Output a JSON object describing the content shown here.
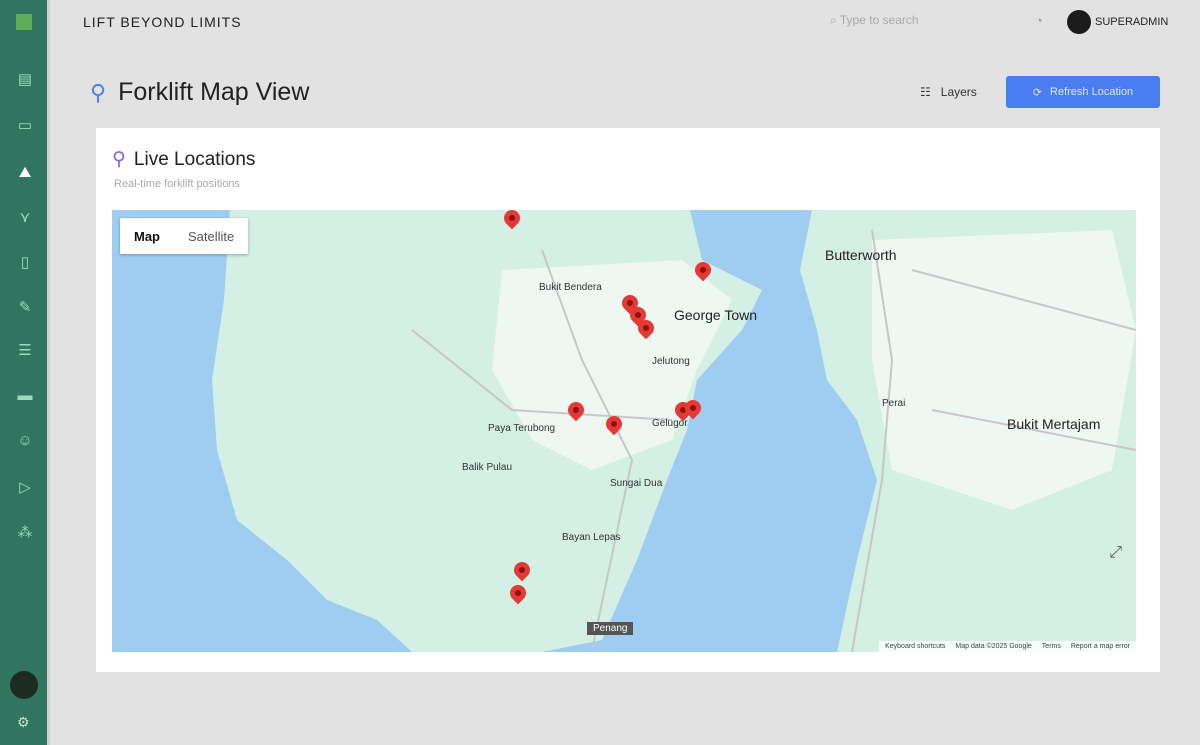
{
  "brand": "LIFT BEYOND LIMITS",
  "search_placeholder": "Type to search",
  "user": "SUPERADMIN",
  "page_title": "Forklift Map View",
  "layers_label": "Layers",
  "refresh_label": "Refresh Location",
  "card": {
    "title": "Live Locations",
    "subtitle": "Real-time forklift positions"
  },
  "map": {
    "type_map": "Map",
    "type_satellite": "Satellite",
    "labels": [
      "Butterworth",
      "George Town",
      "Bukit Bendera",
      "Jelutong",
      "Perai",
      "Bukit Mertajam",
      "Balik Pulau",
      "Sungai Dua",
      "Bayan Lepas",
      "Gelugor",
      "Paya Terubong",
      "Penang"
    ],
    "footer": [
      "Keyboard shortcuts",
      "Map data ©2025 Google",
      "Terms",
      "Report a map error"
    ],
    "marker_count": 11
  },
  "colors": {
    "sidebar": "#2f7560",
    "accent": "#4a7ef0",
    "marker": "#e53935"
  }
}
